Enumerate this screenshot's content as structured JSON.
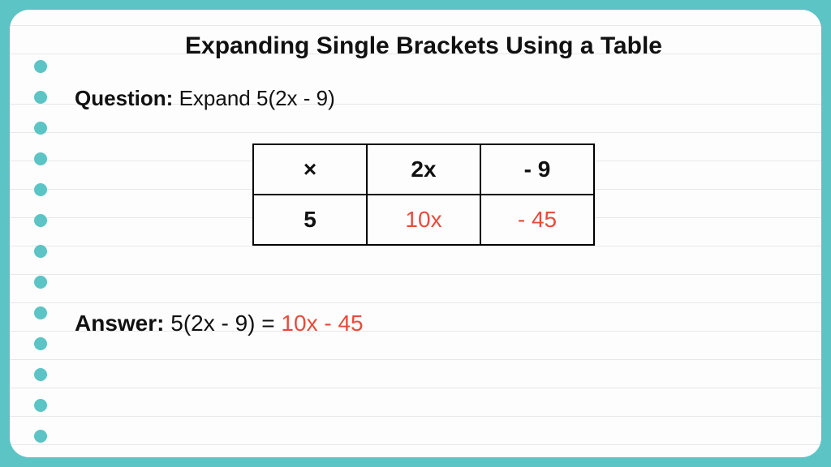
{
  "title": "Expanding Single Brackets Using a Table",
  "question": {
    "label": "Question:",
    "text": "Expand 5(2x - 9)"
  },
  "table": {
    "header": [
      "×",
      "2x",
      "- 9"
    ],
    "row": {
      "lead": "5",
      "cells": [
        "10x",
        "- 45"
      ]
    }
  },
  "answer": {
    "label": "Answer:",
    "expression": "5(2x - 9) =",
    "result": "10x - 45"
  }
}
